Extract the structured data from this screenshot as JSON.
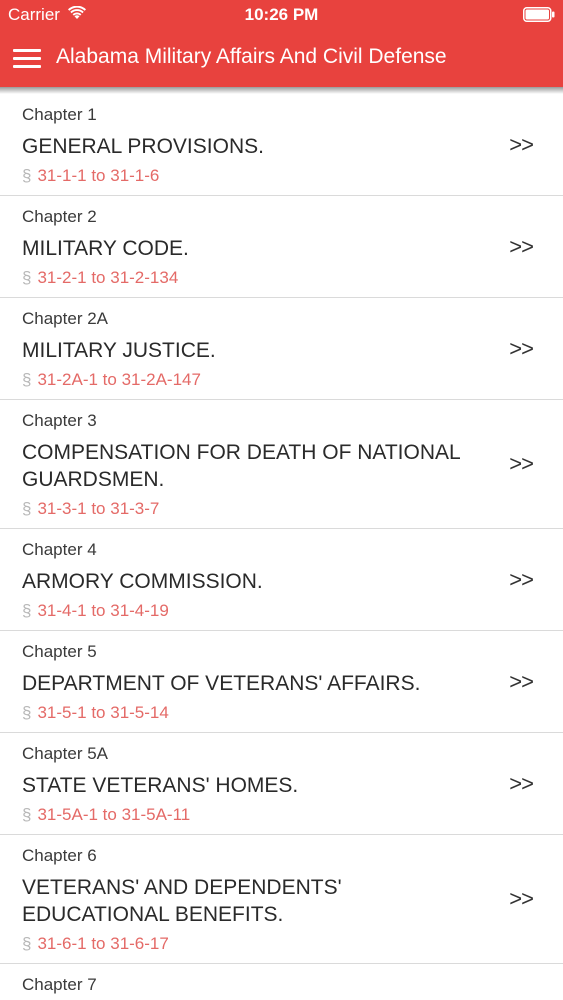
{
  "status_bar": {
    "carrier": "Carrier",
    "time": "10:26 PM",
    "wifi_icon": "wifi-icon",
    "battery_icon": "battery-icon"
  },
  "nav": {
    "title": "Alabama Military Affairs And Civil Defense",
    "menu_icon": "hamburger-menu-icon",
    "bar_color": "#e8423e"
  },
  "section_symbol": "§",
  "chevron": ">>",
  "chapters": [
    {
      "chapter": "Chapter 1",
      "title": "GENERAL PROVISIONS.",
      "range": "31-1-1 to 31-1-6"
    },
    {
      "chapter": "Chapter 2",
      "title": "MILITARY CODE.",
      "range": "31-2-1 to 31-2-134"
    },
    {
      "chapter": "Chapter 2A",
      "title": "MILITARY JUSTICE.",
      "range": "31-2A-1 to 31-2A-147"
    },
    {
      "chapter": "Chapter 3",
      "title": "COMPENSATION FOR DEATH OF NATIONAL GUARDSMEN.",
      "range": "31-3-1 to 31-3-7"
    },
    {
      "chapter": "Chapter 4",
      "title": "ARMORY COMMISSION.",
      "range": "31-4-1 to 31-4-19"
    },
    {
      "chapter": "Chapter 5",
      "title": "DEPARTMENT OF VETERANS' AFFAIRS.",
      "range": "31-5-1 to 31-5-14"
    },
    {
      "chapter": "Chapter 5A",
      "title": "STATE VETERANS' HOMES.",
      "range": "31-5A-1 to 31-5A-11"
    },
    {
      "chapter": "Chapter 6",
      "title": "VETERANS' AND DEPENDENTS' EDUCATIONAL BENEFITS.",
      "range": "31-6-1 to 31-6-17"
    },
    {
      "chapter": "Chapter 7",
      "title": "",
      "range": ""
    }
  ]
}
